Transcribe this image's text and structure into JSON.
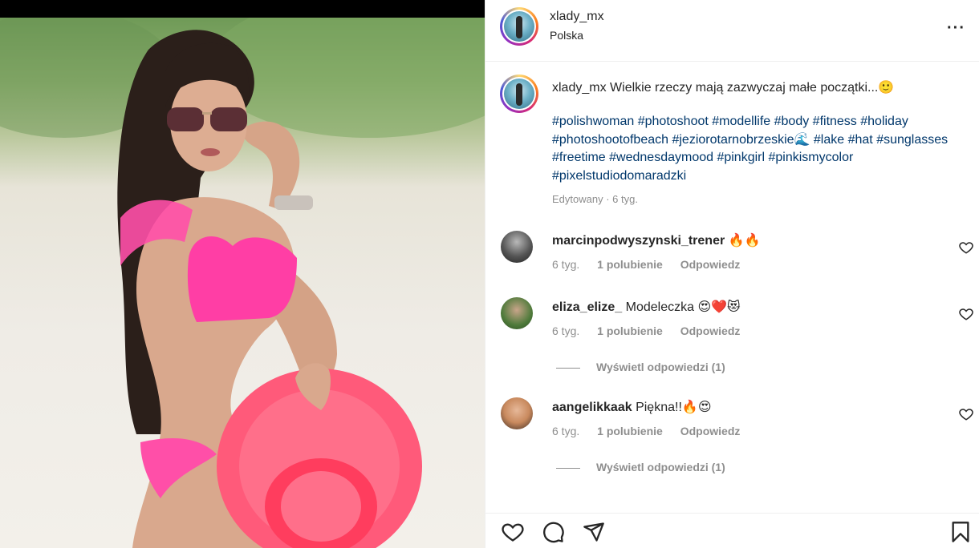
{
  "post": {
    "username": "xlady_mx",
    "location": "Polska",
    "caption": "Wielkie rzeczy mają zazwyczaj małe początki...🙂",
    "hashtags": "#polishwoman #photoshoot #modellife #body #fitness #holiday #photoshootofbeach #jeziorotarnobrzeskie🌊 #lake #hat #sunglasses #freetime #wednesdaymood #pinkgirl #pinkismycolor #pixelstudiodomaradzki",
    "edited": "Edytowany · 6 tyg."
  },
  "comments": [
    {
      "username": "marcinpodwyszynski_trener",
      "text": "🔥🔥",
      "time": "6 tyg.",
      "likes": "1 polubienie",
      "reply": "Odpowiedz",
      "view_replies": ""
    },
    {
      "username": "eliza_elize_",
      "text": "Modeleczka 😍❤️😻",
      "time": "6 tyg.",
      "likes": "1 polubienie",
      "reply": "Odpowiedz",
      "view_replies": "Wyświetl odpowiedzi (1)"
    },
    {
      "username": "aangelikkaak",
      "text": "Piękna!!🔥😍",
      "time": "6 tyg.",
      "likes": "1 polubienie",
      "reply": "Odpowiedz",
      "view_replies": "Wyświetl odpowiedzi (1)"
    }
  ],
  "icons": {
    "more": "more-options-icon",
    "like": "heart-icon",
    "comment": "comment-icon",
    "share": "share-icon",
    "save": "bookmark-icon"
  },
  "colors": {
    "hashtag": "#00376b",
    "muted": "#8e8e8e",
    "bikini": "#ff3ea5"
  }
}
